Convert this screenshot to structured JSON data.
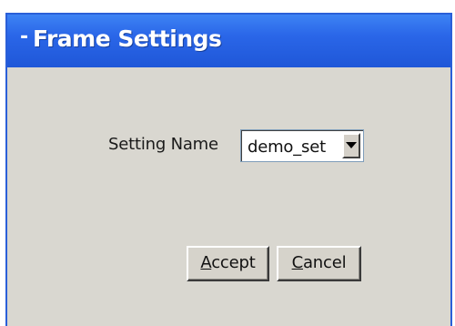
{
  "window": {
    "title": "Frame Settings",
    "collapse_icon": "collapse-dash-icon"
  },
  "form": {
    "setting_label": "Setting Name",
    "setting_value": "demo_set"
  },
  "buttons": {
    "accept_mnemonic": "A",
    "accept_rest": "ccept",
    "cancel_mnemonic": "C",
    "cancel_rest": "ancel"
  },
  "colors": {
    "titlebar": "#2a66e8",
    "panel": "#d9d7d0",
    "title_text": "#ffffff"
  }
}
